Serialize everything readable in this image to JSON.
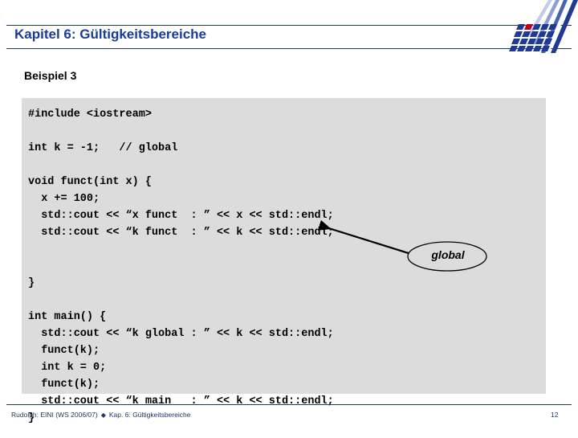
{
  "slide": {
    "title": "Kapitel 6: Gültigkeitsbereiche",
    "section_heading": "Beispiel 3",
    "page_number": "12"
  },
  "logo": {
    "name": "university-logo",
    "accent_color": "#c00020",
    "primary_color": "#1f3a93",
    "stripe_colors": [
      "#1f3a93",
      "#4a63b0",
      "#8fa0d0",
      "#c3cce8"
    ]
  },
  "code": {
    "language": "cpp",
    "lines": [
      "#include <iostream>",
      "",
      "int k = -1;   // global",
      "",
      "void funct(int x) {",
      "  x += 100;",
      "  std::cout << “x funct  : ” << x << std::endl;",
      "  std::cout << “k funct  : ” << k << std::endl;",
      "",
      "",
      "}",
      "",
      "int main() {",
      "  std::cout << “k global : ” << k << std::endl;",
      "  funct(k);",
      "  int k = 0;",
      "  funct(k);",
      "  std::cout << “k main   : ” << k << std::endl;",
      "}"
    ]
  },
  "callout": {
    "label": "global",
    "shape": "ellipse",
    "arrow_target": "k in std::cout << “k funct  : ” << k"
  },
  "footer": {
    "author_course": "Rudolph: EINI (WS 2006/07)",
    "separator": "◆",
    "chapter": "Kap. 6: Gültigkeitsbereiche"
  },
  "colors": {
    "title_blue": "#1a3a9c",
    "rule_blue": "#1f3864",
    "code_background": "#dcdcdc",
    "page_background": "#ffffff"
  }
}
